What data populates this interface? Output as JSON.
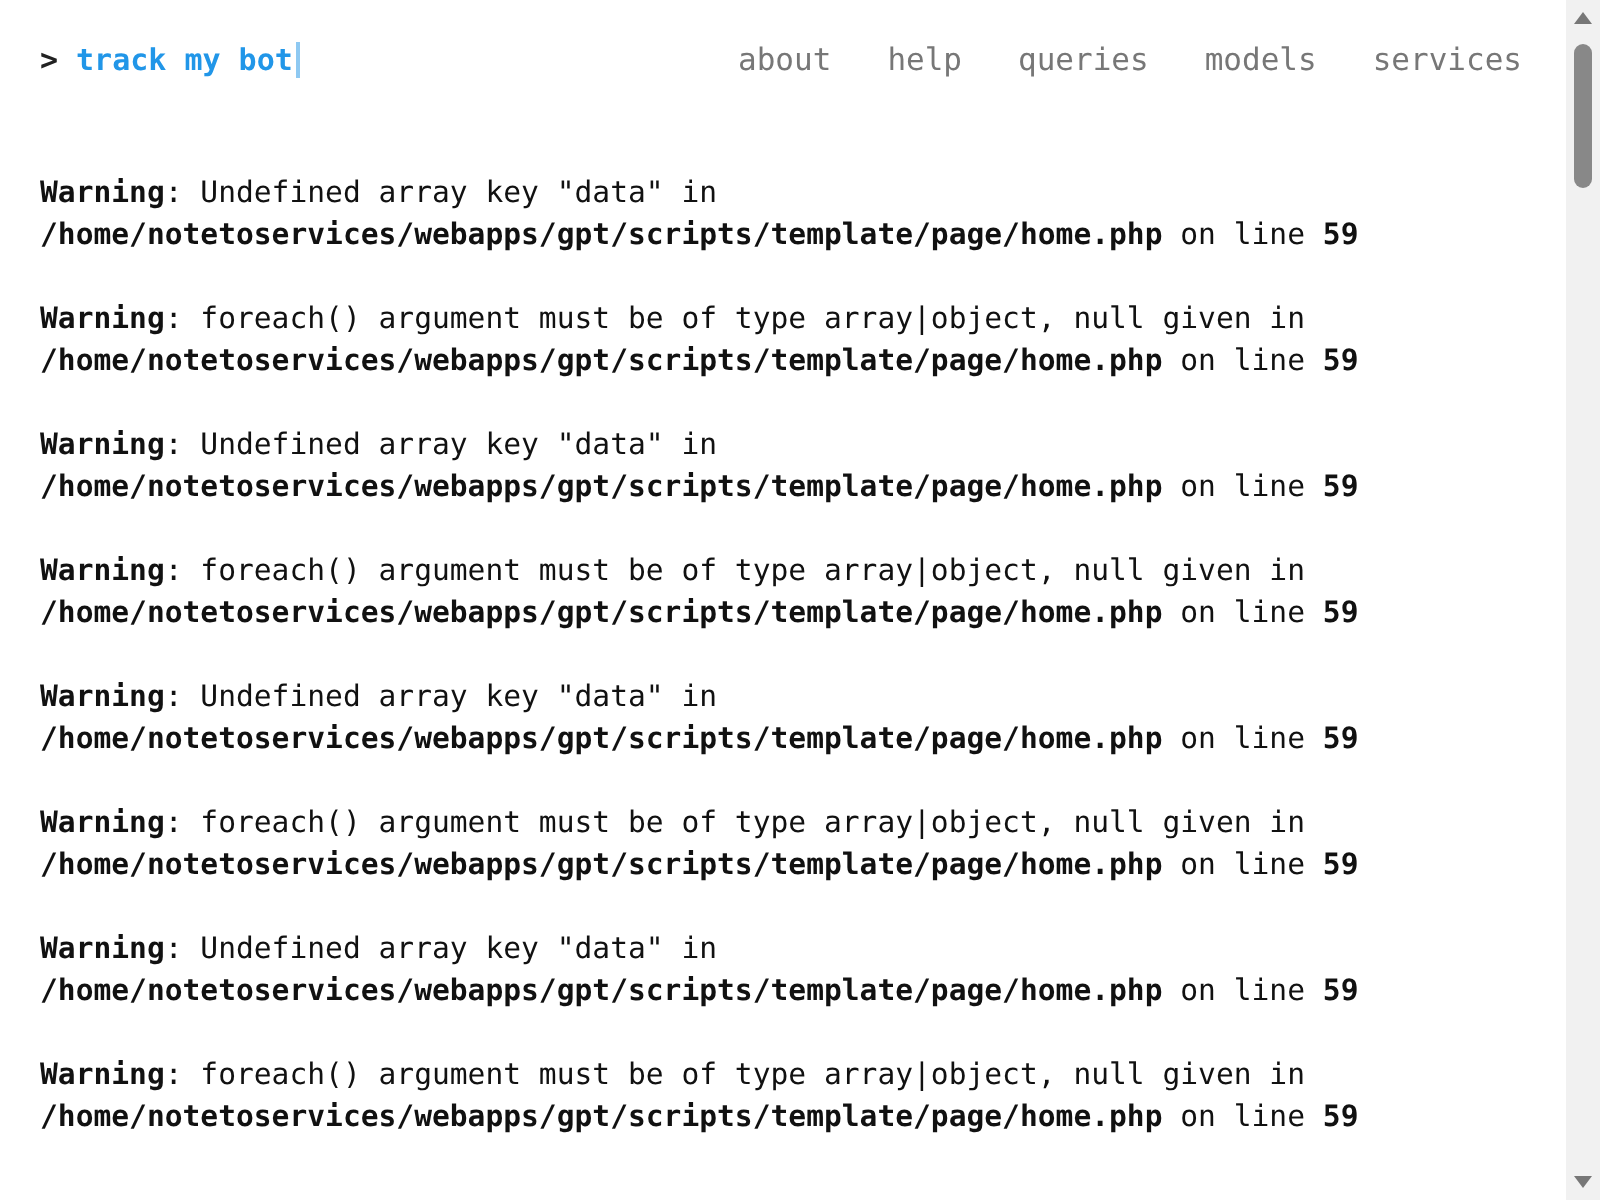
{
  "header": {
    "prompt": ">",
    "title": "track my bot"
  },
  "nav": [
    "about",
    "help",
    "queries",
    "models",
    "services"
  ],
  "messages": [
    {
      "message": "**Warning**: Undefined array key \"data\" in",
      "location": "**/home/notetoservices/webapps/gpt/scripts/template/page/home.php** on line **59**"
    },
    {
      "message": "**Warning**: foreach() argument must be of type array|object, null given in",
      "location": "**/home/notetoservices/webapps/gpt/scripts/template/page/home.php** on line **59**"
    },
    {
      "message": "**Warning**: Undefined array key \"data\" in",
      "location": "**/home/notetoservices/webapps/gpt/scripts/template/page/home.php** on line **59**"
    },
    {
      "message": "**Warning**: foreach() argument must be of type array|object, null given in",
      "location": "**/home/notetoservices/webapps/gpt/scripts/template/page/home.php** on line **59**"
    },
    {
      "message": "**Warning**: Undefined array key \"data\" in",
      "location": "**/home/notetoservices/webapps/gpt/scripts/template/page/home.php** on line **59**"
    },
    {
      "message": "**Warning**: foreach() argument must be of type array|object, null given in",
      "location": "**/home/notetoservices/webapps/gpt/scripts/template/page/home.php** on line **59**"
    },
    {
      "message": "**Warning**: Undefined array key \"data\" in",
      "location": "**/home/notetoservices/webapps/gpt/scripts/template/page/home.php** on line **59**"
    },
    {
      "message": "**Warning**: foreach() argument must be of type array|object, null given in",
      "location": "**/home/notetoservices/webapps/gpt/scripts/template/page/home.php** on line **59**"
    }
  ]
}
